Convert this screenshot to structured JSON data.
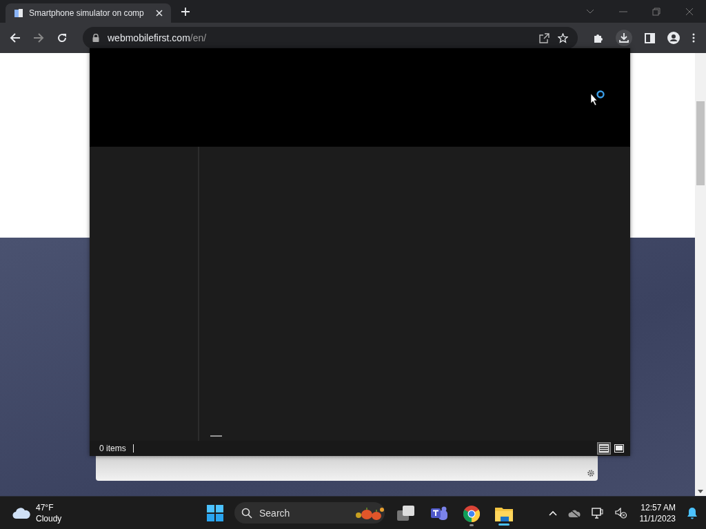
{
  "browser": {
    "tab": {
      "title": "Smartphone simulator on comp",
      "selected": true
    },
    "address": {
      "host": "webmobilefirst.com",
      "path": "/en/"
    }
  },
  "explorer": {
    "status": "0 items",
    "views": [
      {
        "kind": "details",
        "selected": true
      },
      {
        "kind": "tiles",
        "selected": false
      }
    ]
  },
  "taskbar": {
    "weather": {
      "temperature": "47°F",
      "condition": "Cloudy"
    },
    "search": {
      "placeholder": "Search"
    },
    "clock": {
      "time": "12:57 AM",
      "date": "11/1/2023"
    }
  }
}
